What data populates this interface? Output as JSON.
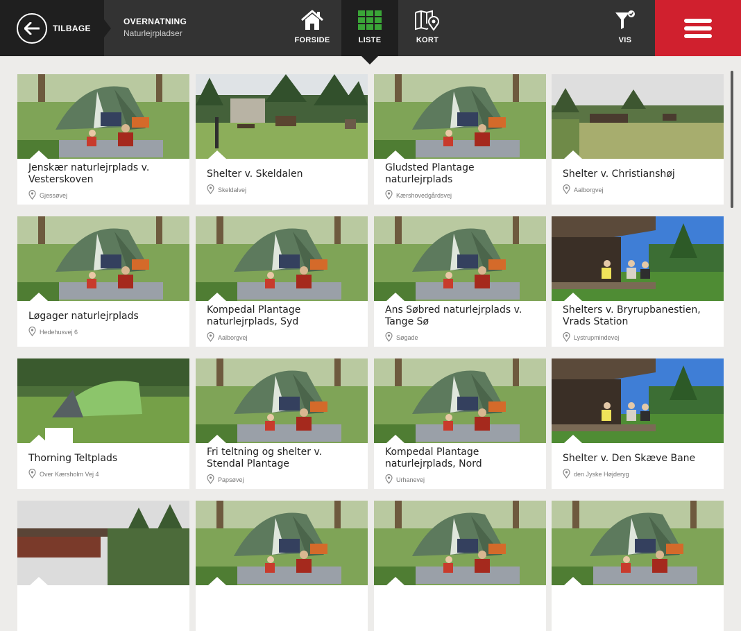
{
  "header": {
    "back_label": "TILBAGE",
    "crumb_title": "OVERNATNING",
    "crumb_subtitle": "Naturlejrpladser",
    "nav": {
      "home": "FORSIDE",
      "list": "LISTE",
      "map": "KORT",
      "filter": "VIS"
    }
  },
  "colors": {
    "accent_red": "#d0202e",
    "active_green": "#3aa537",
    "topbar": "#333333"
  },
  "cards": [
    {
      "title": "Jenskær naturlejrplads v. Vesterskoven",
      "address": "Gjessøvej",
      "image": "tent"
    },
    {
      "title": "Shelter v. Skeldalen",
      "address": "Skeldalvej",
      "image": "forest-clearing"
    },
    {
      "title": "Gludsted Plantage naturlejrplads",
      "address": "Kærshovedgårdsvej",
      "image": "tent"
    },
    {
      "title": "Shelter v. Christianshøj",
      "address": "Aalborgvej",
      "image": "meadow-shelter"
    },
    {
      "title": "Løgager naturlejrplads",
      "address": "Hedehusvej 6",
      "image": "tent"
    },
    {
      "title": "Kompedal Plantage naturlejrplads, Syd",
      "address": "Aalborgvej",
      "image": "tent"
    },
    {
      "title": "Ans Søbred naturlejrplads v. Tange Sø",
      "address": "Søgade",
      "image": "tent"
    },
    {
      "title": "Shelters v. Bryrupbanestien, Vrads Station",
      "address": "Lystrupmindevej",
      "image": "shelter-people"
    },
    {
      "title": "Thorning Teltplads",
      "address": "Over Kærsholm Vej 4",
      "image": "green-tent"
    },
    {
      "title": "Fri teltning og shelter v. Stendal Plantage",
      "address": "Papsøvej",
      "image": "tent"
    },
    {
      "title": "Kompedal Plantage naturlejrplads, Nord",
      "address": "Urhanevej",
      "image": "tent"
    },
    {
      "title": "Shelter v. Den Skæve Bane",
      "address": "den Jyske Højderyg",
      "image": "shelter-people"
    },
    {
      "title": "",
      "address": "",
      "image": "shelter-roof"
    },
    {
      "title": "",
      "address": "",
      "image": "tent"
    },
    {
      "title": "",
      "address": "",
      "image": "tent"
    },
    {
      "title": "",
      "address": "",
      "image": "tent"
    }
  ]
}
